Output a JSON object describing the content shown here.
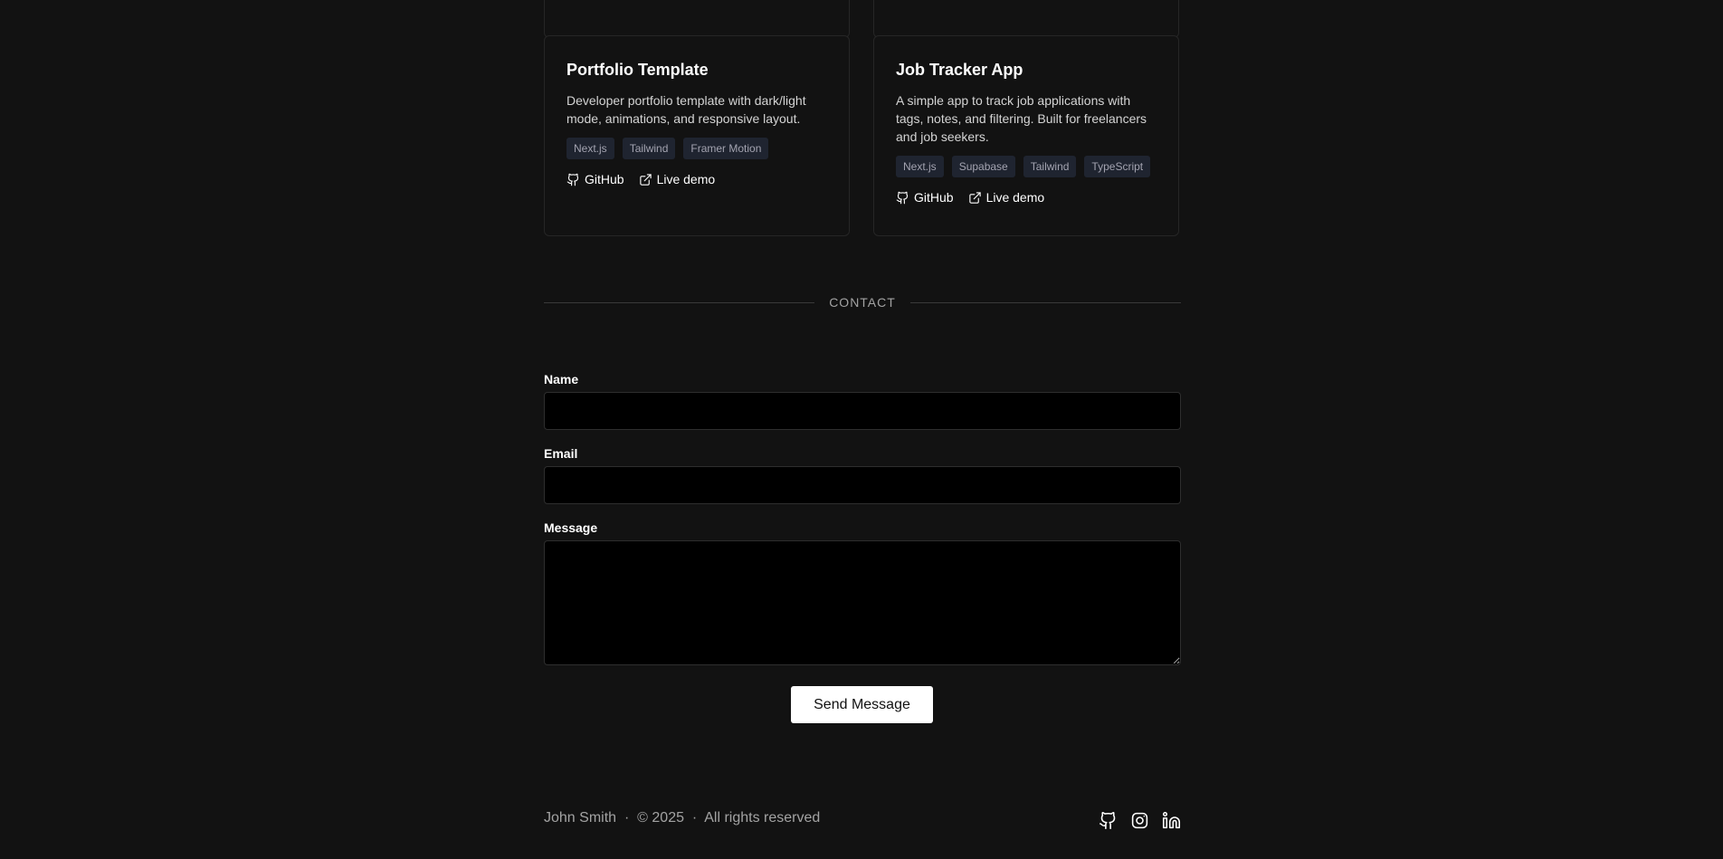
{
  "projects": [
    {
      "title": "Portfolio Template",
      "description": "Developer portfolio template with dark/light mode, animations, and responsive layout.",
      "tags": [
        "Next.js",
        "Tailwind",
        "Framer Motion"
      ],
      "github_label": "GitHub",
      "demo_label": "Live demo"
    },
    {
      "title": "Job Tracker App",
      "description": "A simple app to track job applications with tags, notes, and filtering. Built for freelancers and job seekers.",
      "tags": [
        "Next.js",
        "Supabase",
        "Tailwind",
        "TypeScript"
      ],
      "github_label": "GitHub",
      "demo_label": "Live demo"
    }
  ],
  "contact": {
    "heading": "CONTACT",
    "name_label": "Name",
    "name_value": "",
    "email_label": "Email",
    "email_value": "",
    "message_label": "Message",
    "message_value": "",
    "submit_label": "Send Message"
  },
  "footer": {
    "name": "John Smith",
    "separator": "·",
    "copyright": "© 2025",
    "rights": "All rights reserved",
    "social_icons": [
      "github-icon",
      "instagram-icon",
      "linkedin-icon"
    ]
  },
  "colors": {
    "background": "#121212",
    "card_border": "#262626",
    "tag_bg": "#1f2430",
    "input_bg": "#000000",
    "button_bg": "#ffffff"
  }
}
